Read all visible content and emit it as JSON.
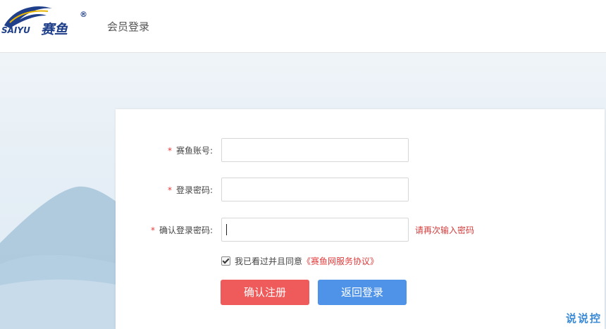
{
  "header": {
    "brand_text": "SAIYU",
    "brand_cn": "赛鱼",
    "registered_mark": "®",
    "page_title": "会员登录"
  },
  "form": {
    "fields": [
      {
        "required_mark": "*",
        "label": "赛鱼账号:",
        "value": ""
      },
      {
        "required_mark": "*",
        "label": "登录密码:",
        "value": ""
      },
      {
        "required_mark": "*",
        "label": "确认登录密码:",
        "value": "",
        "hint": "请再次输入密码"
      }
    ],
    "agreement": {
      "checked": true,
      "text": "我已看过并且同意",
      "link": "《赛鱼网服务协议》"
    },
    "buttons": {
      "register": "确认注册",
      "back": "返回登录"
    }
  },
  "watermark": "说说控",
  "colors": {
    "required": "#e23b3b",
    "register_button": "#ef5b5b",
    "back_button": "#4f93e9",
    "brand_blue": "#1f3f8a"
  }
}
